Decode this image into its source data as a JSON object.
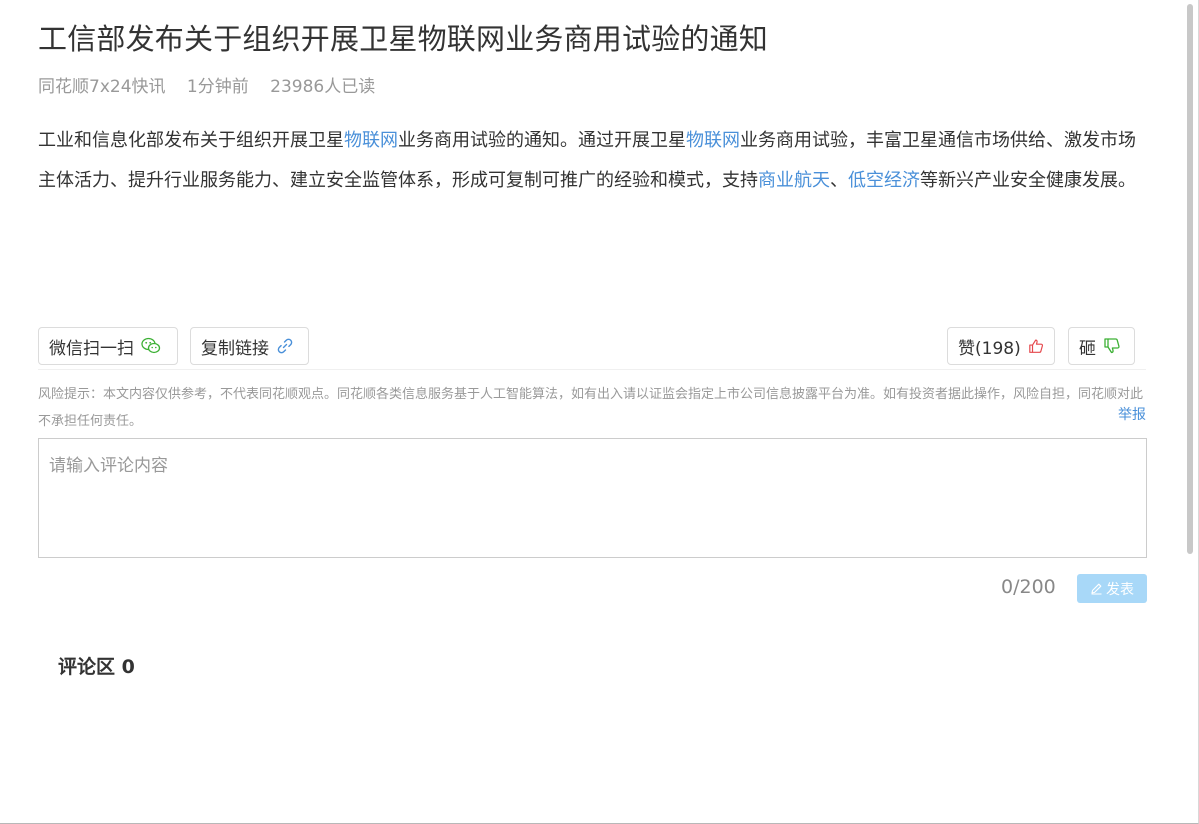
{
  "article": {
    "title": "工信部发布关于组织开展卫星物联网业务商用试验的通知",
    "meta": {
      "source": "同花顺7x24快讯",
      "time": "1分钟前",
      "reads": "23986人已读"
    },
    "body": {
      "p1": "工业和信息化部发布关于组织开展卫星",
      "kw1": "物联网",
      "p2": "业务商用试验的通知。通过开展卫星",
      "kw2": "物联网",
      "p3": "业务商用试验，丰富卫星通信市场供给、激发市场主体活力、提升行业服务能力、建立安全监管体系，形成可复制可推广的经验和模式，支持",
      "kw3": "商业航天",
      "p4": "、",
      "kw4": "低空经济",
      "p5": "等新兴产业安全健康发展。"
    }
  },
  "actions": {
    "wechat_label": "微信扫一扫",
    "copy_label": "复制链接",
    "like_label": "赞(198)",
    "dislike_label": "砸"
  },
  "risk_notice": "风险提示：本文内容仅供参考，不代表同花顺观点。同花顺各类信息服务基于人工智能算法，如有出入请以证监会指定上市公司信息披露平台为准。如有投资者据此操作，风险自担，同花顺对此不承担任何责任。",
  "report_label": "举报",
  "comment": {
    "placeholder": "请输入评论内容",
    "counter": "0/200",
    "publish_label": "发表"
  },
  "comments_section": {
    "title": "评论区 0"
  },
  "colors": {
    "link": "#4a90d9",
    "wechat_green": "#3cb034",
    "like_red": "#e5484d",
    "dislike_green": "#3cb034",
    "publish_bg": "#a8d8f8"
  }
}
